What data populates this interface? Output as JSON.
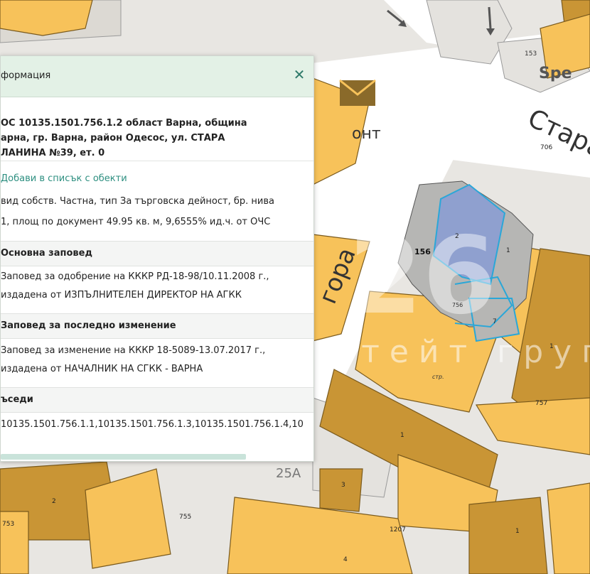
{
  "panel": {
    "title": "формация",
    "close_icon": "close-icon",
    "address": [
      "ОС 10135.1501.756.1.2 област Варна, община",
      "арна, гр. Варна, район Одесос, ул. СТАРА",
      "ЛАНИНА №39, ет. 0"
    ],
    "add_link": "Добави в списък с обекти",
    "details": [
      "вид собств. Частна, тип За търговска дейност, бр. нива",
      "1, площ по документ 49.95 кв. м, 9,6555% ид.ч. от ОЧС"
    ],
    "sections": [
      {
        "heading": "Основна заповед",
        "lines": [
          "Заповед за одобрение на КККР РД-18-98/10.11.2008 г.,",
          "издадена от ИЗПЪЛНИТЕЛЕН ДИРЕКТОР НА АГКК"
        ]
      },
      {
        "heading": "Заповед за последно изменение",
        "lines": [
          "Заповед за изменение на КККР 18-5089-13.07.2017 г.,",
          "издадена от НАЧАЛНИК НА СГКК - ВАРНА"
        ]
      },
      {
        "heading": "ъседи",
        "lines": [
          "10135.1501.756.1.1,10135.1501.756.1.3,10135.1501.756.1.4,10"
        ]
      }
    ]
  },
  "map": {
    "street_label_1": "Стара",
    "street_label_2": "гора",
    "street_partial": "онт",
    "spe_label": "Spe",
    "number_153": "153",
    "parcel_labels": [
      "706",
      "2",
      "156",
      "1",
      "7",
      "1",
      "757",
      "1",
      "3",
      "2",
      "753",
      "755",
      "1207",
      "4",
      "1",
      "25А",
      "стр.",
      "756"
    ],
    "watermark": "стейт груп",
    "mail_icon": "mail-icon",
    "arrow_icon": "arrow-icon"
  },
  "colors": {
    "building_orange": "#f7c25a",
    "building_brown": "#c99535",
    "building_outline": "#7a5a1d",
    "selected_fill": "#8fa0cf",
    "selected_outline": "#2aa7d8",
    "gray_unit": "#b6b6b4",
    "panel_header": "#e3f1e6",
    "link_color": "#2d8f80"
  }
}
